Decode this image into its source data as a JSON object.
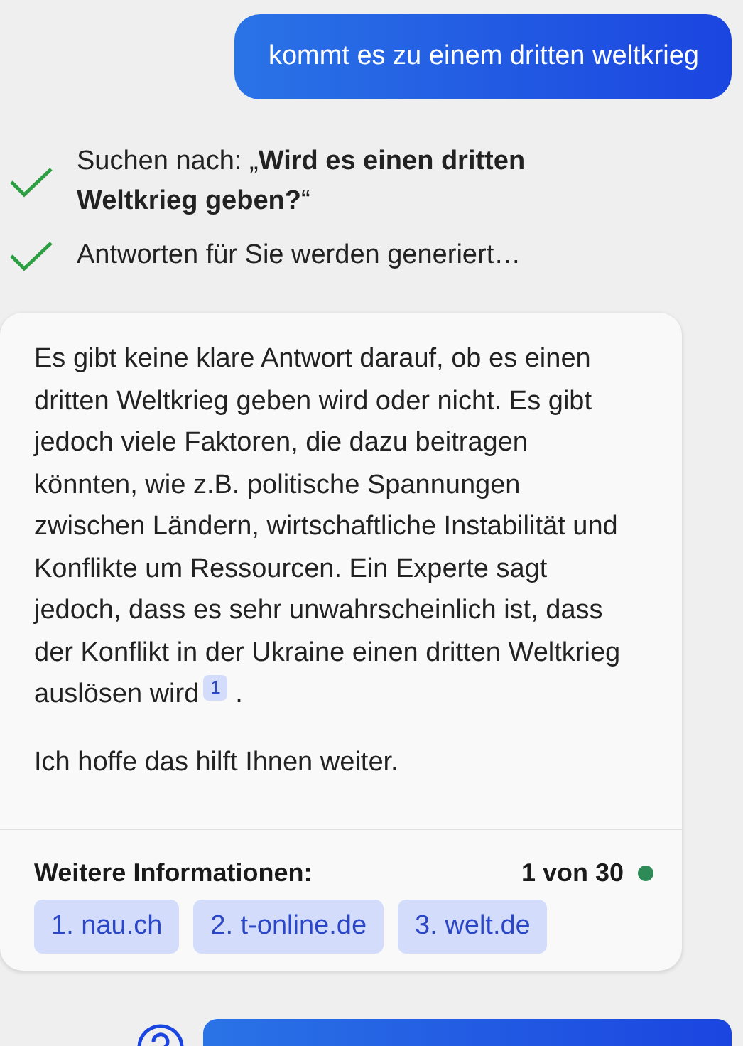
{
  "user_message": {
    "text": "kommt es zu einem dritten weltkrieg"
  },
  "steps": [
    {
      "text": "Suchen nach: „**Wird es einen dritten Weltkrieg geben?**“",
      "done": true
    },
    {
      "text": "Antworten für Sie werden generiert…",
      "done": true
    }
  ],
  "answer": {
    "paragraphs": [
      {
        "text": "Es gibt keine klare Antwort darauf, ob es einen dritten Weltkrieg geben wird oder nicht. Es gibt jedoch viele Faktoren, die dazu beitragen könnten, wie z.B. politische Spannungen zwischen Ländern, wirtschaftliche Instabilität und Konflikte um Ressourcen. Ein Experte sagt jedoch, dass es sehr unwahrscheinlich ist, dass der Konflikt in der Ukraine einen dritten Weltkrieg auslösen wird",
        "citation": "1",
        "after": "."
      },
      {
        "text": "Ich hoffe das hilft Ihnen weiter."
      }
    ],
    "more_info_label": "Weitere Informationen:",
    "counter": "1 von 30",
    "sources": [
      "1. nau.ch",
      "2. t-online.de",
      "3. welt.de"
    ]
  }
}
